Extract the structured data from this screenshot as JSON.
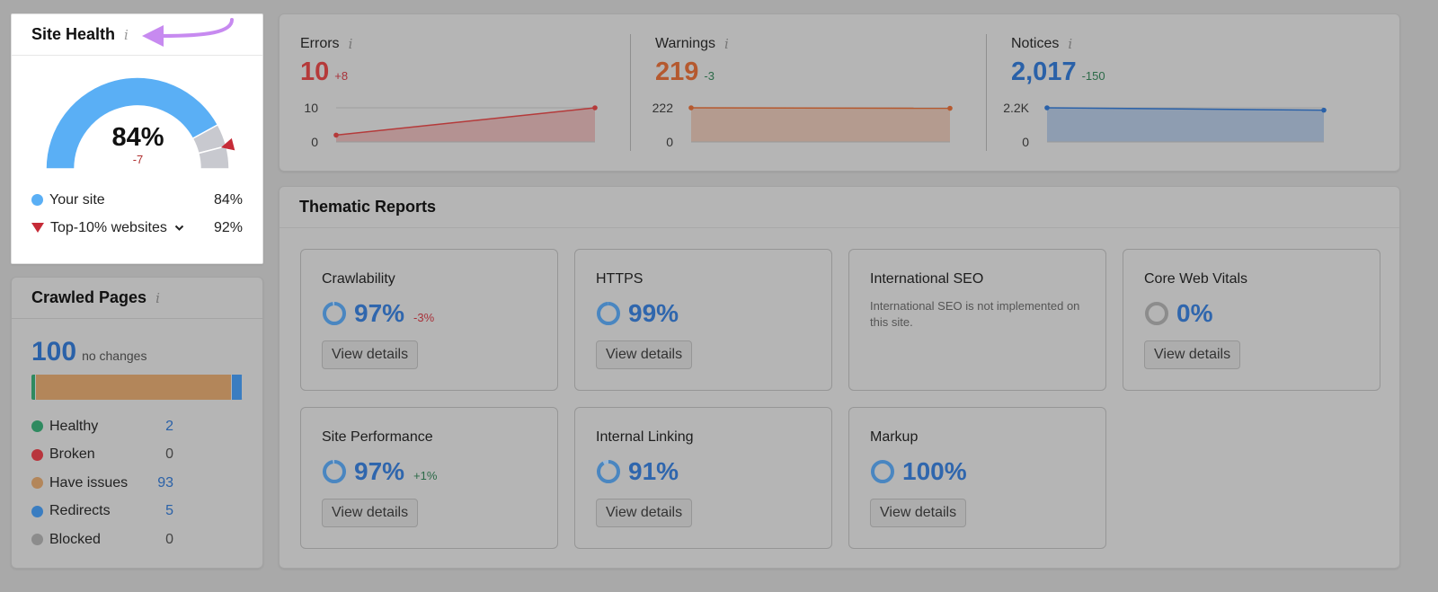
{
  "colors": {
    "page_bg": "#a9a9a9",
    "gauge_your_site": "#5aaff5",
    "gauge_remainder": "#c8c9cf",
    "top10_marker": "#c62b37",
    "annotation_arrow": "#c78af0",
    "errors": "#b53a3a",
    "warnings": "#b5592f",
    "notices": "#2a61a8",
    "healthy": "#2f8a60",
    "broken": "#b8353d",
    "have_issues": "#b3865a",
    "redirects": "#3a7dc1",
    "blocked": "#8c8c8c",
    "report_ring": "#4a86c0",
    "report_ring_empty": "#8c8c8c"
  },
  "site_health": {
    "title": "Site Health",
    "info_icon": "info-icon",
    "score": 84,
    "score_label": "84%",
    "delta": "-7",
    "top10_score": 92,
    "legend": [
      {
        "marker": "dot",
        "label": "Your site",
        "value": "84%"
      },
      {
        "marker": "triangle-down",
        "label": "Top-10% websites",
        "value": "92%",
        "dropdown": true
      }
    ],
    "chevron_icon": "chevron-down-icon",
    "annotation": "arrow-pointing-to-info-icon"
  },
  "crawled_pages": {
    "title": "Crawled Pages",
    "total": "100",
    "total_note": "no changes",
    "segments": [
      {
        "label": "Healthy",
        "value": 2,
        "color_key": "healthy"
      },
      {
        "label": "Broken",
        "value": 0,
        "color_key": "broken"
      },
      {
        "label": "Have issues",
        "value": 93,
        "color_key": "have_issues"
      },
      {
        "label": "Redirects",
        "value": 5,
        "color_key": "redirects"
      },
      {
        "label": "Blocked",
        "value": 0,
        "color_key": "blocked"
      }
    ]
  },
  "metrics": [
    {
      "key": "errors",
      "title": "Errors",
      "value": "10",
      "delta": "+8",
      "delta_type": "neg",
      "y_max_label": "10",
      "y_min_label": "0",
      "y_max": 10,
      "points": [
        2,
        10
      ],
      "color_key": "errors"
    },
    {
      "key": "warnings",
      "title": "Warnings",
      "value": "219",
      "delta": "-3",
      "delta_type": "pos",
      "y_max_label": "222",
      "y_min_label": "0",
      "y_max": 222,
      "points": [
        222,
        219
      ],
      "color_key": "warnings"
    },
    {
      "key": "notices",
      "title": "Notices",
      "value": "2,017",
      "delta": "-150",
      "delta_type": "pos",
      "y_max_label": "2.2K",
      "y_min_label": "0",
      "y_max": 2167,
      "points": [
        2167,
        2017
      ],
      "color_key": "notices"
    }
  ],
  "thematic": {
    "title": "Thematic Reports",
    "button_label": "View details",
    "reports": [
      {
        "title": "Crawlability",
        "score": 97,
        "score_label": "97%",
        "change": "-3%",
        "change_type": "neg"
      },
      {
        "title": "HTTPS",
        "score": 99,
        "score_label": "99%",
        "change": "",
        "change_type": ""
      },
      {
        "title": "International SEO",
        "description": "International SEO is not implemented on this site."
      },
      {
        "title": "Core Web Vitals",
        "score": 0,
        "score_label": "0%",
        "change": "",
        "change_type": ""
      },
      {
        "title": "Site Performance",
        "score": 97,
        "score_label": "97%",
        "change": "+1%",
        "change_type": "pos"
      },
      {
        "title": "Internal Linking",
        "score": 91,
        "score_label": "91%",
        "change": "",
        "change_type": ""
      },
      {
        "title": "Markup",
        "score": 100,
        "score_label": "100%",
        "change": "",
        "change_type": ""
      }
    ]
  }
}
